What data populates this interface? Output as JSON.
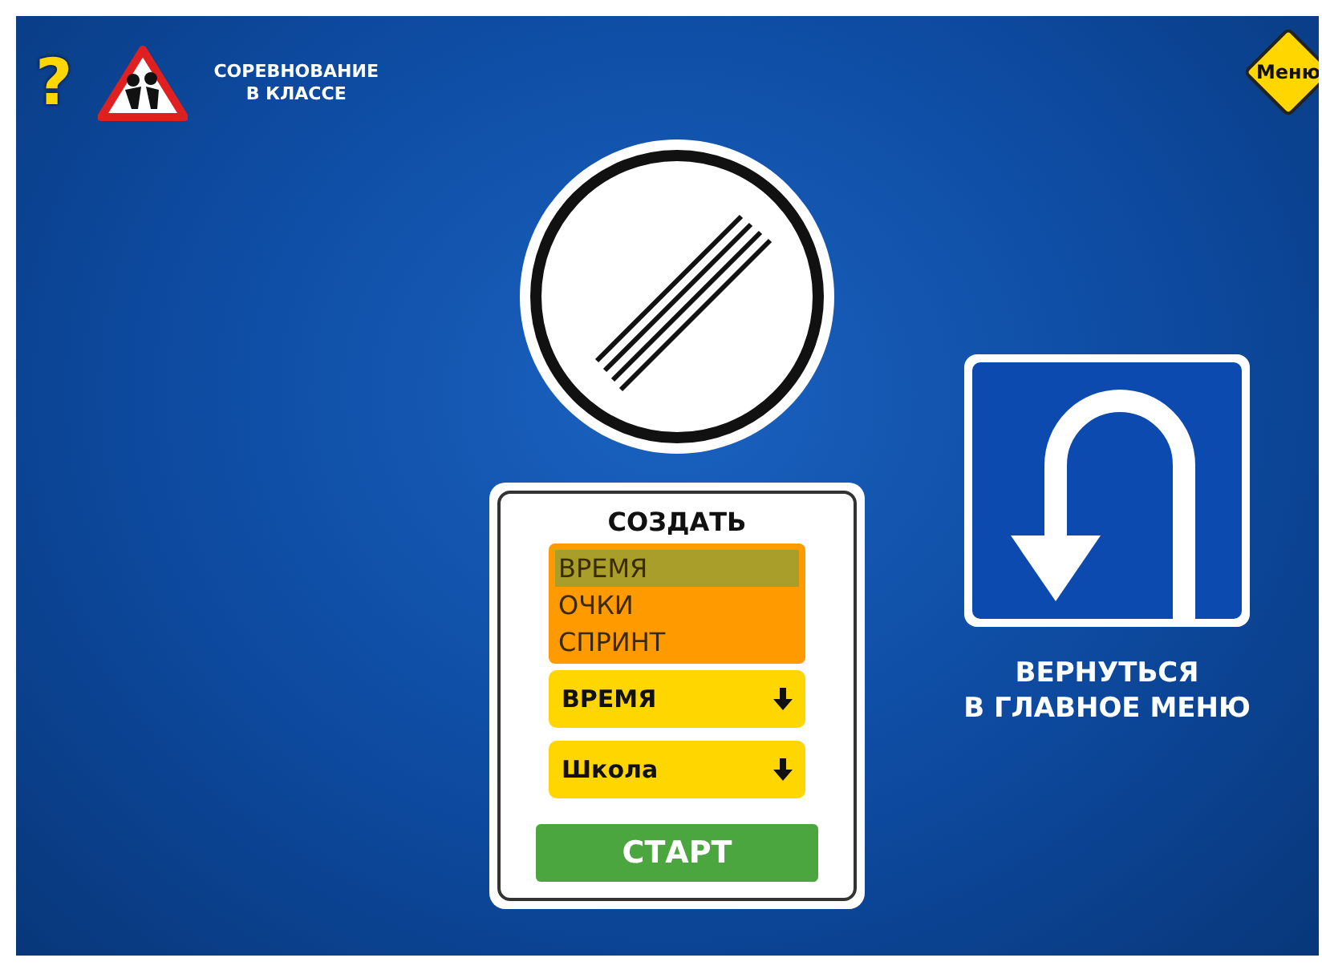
{
  "header": {
    "help_label": "?",
    "title": "СОРЕВНОВАНИЕ\nВ КЛАССЕ",
    "menu_label": "Меню"
  },
  "create_card": {
    "title": "СОЗДАТЬ",
    "mode_options": [
      {
        "label": "ВРЕМЯ",
        "selected": true
      },
      {
        "label": "ОЧКИ",
        "selected": false
      },
      {
        "label": "СПРИНТ",
        "selected": false
      }
    ],
    "selects": [
      {
        "value": "ВРЕМЯ"
      },
      {
        "value": "Школа"
      }
    ],
    "start_button": "СТАРТ"
  },
  "back": {
    "label": "ВЕРНУТЬСЯ\nВ ГЛАВНОЕ МЕНЮ"
  }
}
